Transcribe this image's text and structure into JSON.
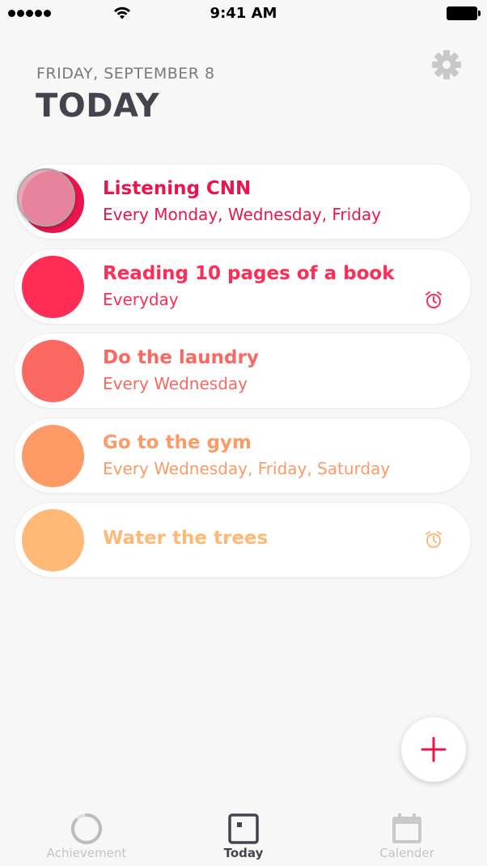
{
  "status_bar": {
    "time": "9:41 AM"
  },
  "header": {
    "date": "FRIDAY, SEPTEMBER 8",
    "title": "TODAY",
    "settings_icon": "gear-icon"
  },
  "habits": [
    {
      "name": "Listening CNN",
      "schedule": "Every Monday, Wednesday, Friday",
      "color": "#e8164d",
      "alarm": false,
      "pressed": true
    },
    {
      "name": "Reading 10 pages of a book",
      "schedule": "Everyday",
      "color": "#ff2d55",
      "alarm": true
    },
    {
      "name": "Do the laundry",
      "schedule": "Every Wednesday",
      "color": "#fb6862",
      "alarm": false
    },
    {
      "name": "Go to the gym",
      "schedule": "Every Wednesday, Friday, Saturday",
      "color": "#fd9a66",
      "alarm": false
    },
    {
      "name": "Water the trees",
      "schedule": "",
      "color": "#ffb977",
      "alarm": true
    }
  ],
  "fab": {
    "icon": "plus-icon",
    "color": "#e8164d"
  },
  "tabs": [
    {
      "label": "Achievement",
      "icon": "progress-ring-icon",
      "active": false
    },
    {
      "label": "Today",
      "icon": "today-square-icon",
      "active": true
    },
    {
      "label": "Calender",
      "icon": "calendar-icon",
      "active": false
    }
  ]
}
